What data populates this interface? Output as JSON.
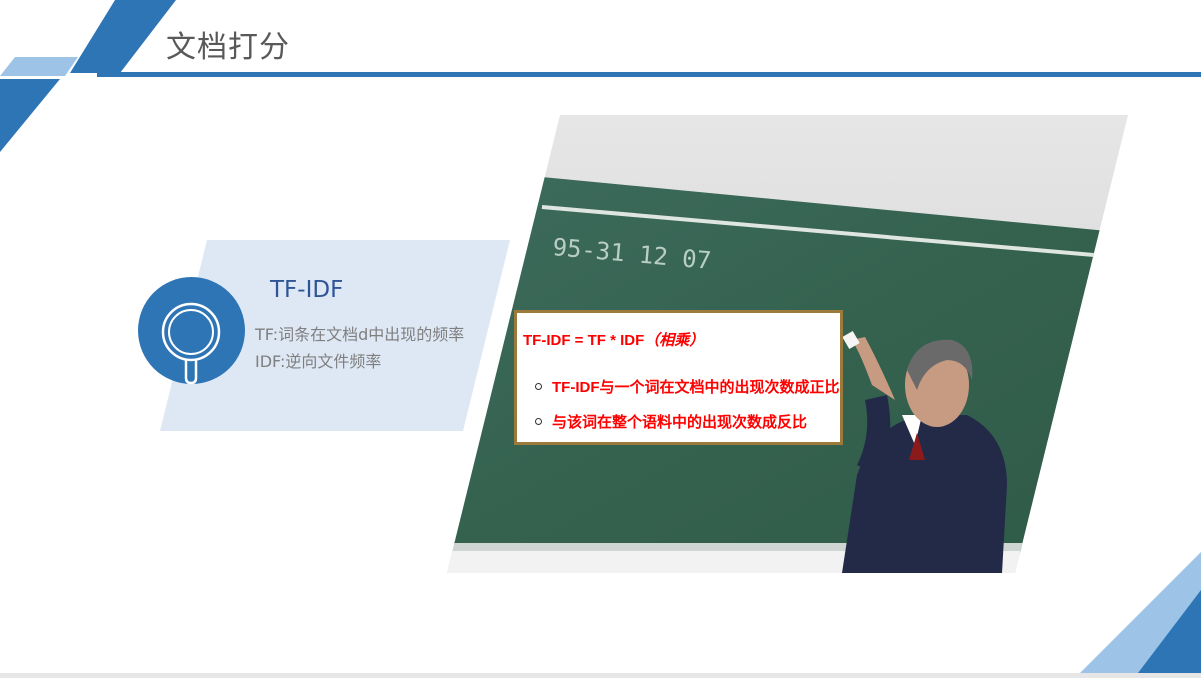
{
  "slide": {
    "title": "文档打分"
  },
  "card": {
    "heading": "TF-IDF",
    "lines": [
      "TF:词条在文档d中出现的频率",
      "IDF:逆向文件频率"
    ],
    "icon": "magnifier-icon"
  },
  "formula_box": {
    "formula": "TF-IDF = TF * IDF",
    "formula_note": "（相乘）",
    "bullets": [
      "TF-IDF与一个词在文档中的出现次数成正比",
      "与该词在整个语料中的出现次数成反比"
    ]
  },
  "photo": {
    "board_text": "95-31 12 07"
  },
  "colors": {
    "accent": "#2e75b6",
    "accent_light": "#9dc3e6",
    "card_bg": "#dee8f5",
    "heading": "#2f5597",
    "text": "#7f7f7f",
    "formula": "#ff0000"
  }
}
